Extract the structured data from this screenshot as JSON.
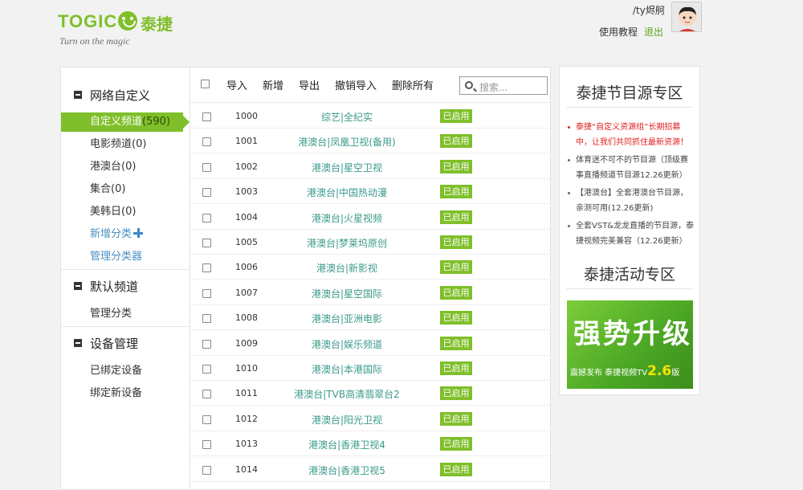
{
  "header": {
    "logo_word": "TOGIC",
    "logo_cn": "泰捷",
    "logo_tagline": "Turn on the magic",
    "user_name": "/ty烬舸",
    "help_label": "使用教程",
    "logout_label": "退出"
  },
  "sidebar": {
    "section1": "网络自定义",
    "active_item": "自定义频道",
    "active_count": "(590)",
    "items": [
      {
        "label": "电影频道",
        "count": "(0)"
      },
      {
        "label": "港澳台",
        "count": "(0)"
      },
      {
        "label": "集合",
        "count": "(0)"
      },
      {
        "label": "美韩日",
        "count": "(0)"
      }
    ],
    "add_category": "新增分类",
    "manage_categories": "管理分类器",
    "section2": "默认频道",
    "manage_label": "管理分类",
    "section3": "设备管理",
    "bound_devices": "已绑定设备",
    "bind_new": "绑定新设备"
  },
  "toolbar": {
    "import": "导入",
    "add": "新增",
    "export": "导出",
    "undo_import": "撤销导入",
    "delete_all": "删除所有",
    "search_placeholder": "搜索..."
  },
  "channels": [
    {
      "id": "1000",
      "name": "综艺|全纪实",
      "status": "已启用"
    },
    {
      "id": "1001",
      "name": "港澳台|凤凰卫视(备用)",
      "status": "已启用"
    },
    {
      "id": "1002",
      "name": "港澳台|星空卫视",
      "status": "已启用"
    },
    {
      "id": "1003",
      "name": "港澳台|中国热动漫",
      "status": "已启用"
    },
    {
      "id": "1004",
      "name": "港澳台|火星视频",
      "status": "已启用"
    },
    {
      "id": "1005",
      "name": "港澳台|梦莱坞原创",
      "status": "已启用"
    },
    {
      "id": "1006",
      "name": "港澳台|新影视",
      "status": "已启用"
    },
    {
      "id": "1007",
      "name": "港澳台|星空国际",
      "status": "已启用"
    },
    {
      "id": "1008",
      "name": "港澳台|亚洲电影",
      "status": "已启用"
    },
    {
      "id": "1009",
      "name": "港澳台|娱乐频道",
      "status": "已启用"
    },
    {
      "id": "1010",
      "name": "港澳台|本港国际",
      "status": "已启用"
    },
    {
      "id": "1011",
      "name": "港澳台|TVB高清翡翠台2",
      "status": "已启用"
    },
    {
      "id": "1012",
      "name": "港澳台|阳光卫视",
      "status": "已启用"
    },
    {
      "id": "1013",
      "name": "港澳台|香港卫视4",
      "status": "已启用"
    },
    {
      "id": "1014",
      "name": "港澳台|香港卫视5",
      "status": "已启用"
    }
  ],
  "right_panel": {
    "source_title": "泰捷节目源专区",
    "news": [
      {
        "text": "泰捷“自定义资源组”长期招募中，让我们共同抓住最新资源！",
        "highlight": true
      },
      {
        "text": "体育迷不可不的节目源（顶级赛事直播频道节目源12.26更新）",
        "highlight": false
      },
      {
        "text": "【港澳台】全套港澳台节目源，亲测可用(12.26更新)",
        "highlight": false
      },
      {
        "text": "全套VST&龙龙直播的节目源，泰捷视频完美兼容（12.26更新）",
        "highlight": false
      }
    ],
    "activity_title": "泰捷活动专区",
    "banner_big": "强势升级",
    "banner_small": "震撼发布 泰捷视频TV",
    "banner_version": "2.6",
    "banner_suffix": "版"
  },
  "colors": {
    "brand_green": "#7fbf2a",
    "link_blue": "#4a90c2",
    "channel_teal": "#3a9a8a",
    "alert_red": "#e02020"
  }
}
